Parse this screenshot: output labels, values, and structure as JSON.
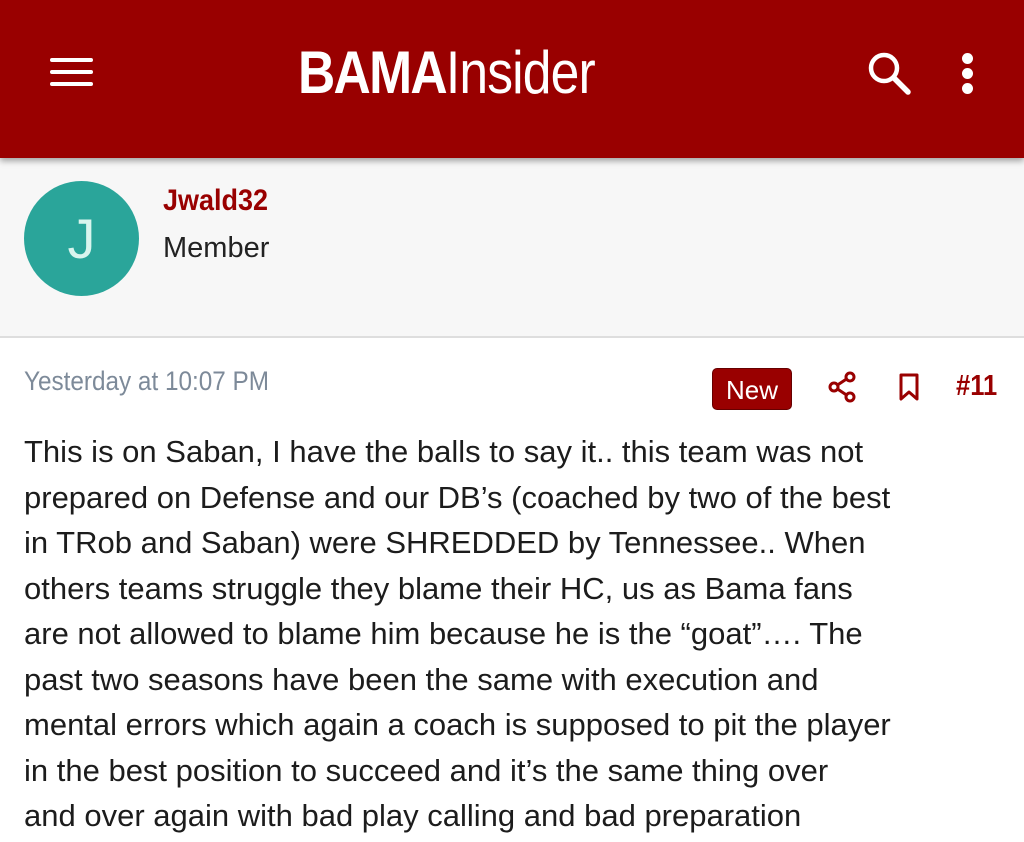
{
  "header": {
    "logo_bold": "BAMA",
    "logo_thin": "Insider",
    "menu_icon": "hamburger-menu-icon",
    "search_icon": "search-icon",
    "more_icon": "more-vertical-icon",
    "background_color": "#990000"
  },
  "user": {
    "avatar_letter": "J",
    "avatar_color": "#2aa59a",
    "username": "Jwald32",
    "title": "Member"
  },
  "post": {
    "timestamp": "Yesterday at 10:07 PM",
    "badge": "New",
    "share_icon": "share-icon",
    "bookmark_icon": "bookmark-icon",
    "post_number": "#11",
    "body_lines": [
      "This is on Saban, I have the balls to say it.. this team was not",
      "prepared on Defense and our DB’s (coached by two of the best",
      "in TRob and Saban) were SHREDDED by Tennessee.. When",
      "others teams struggle they blame their HC, us as Bama fans",
      "are not allowed to blame him because he is the “goat”…. The",
      "past two seasons have been the same with execution and",
      "mental errors which again a coach is supposed to pit the player",
      "in the best position to succeed and it’s the same thing over",
      "and over again with bad play calling and bad preparation"
    ]
  }
}
